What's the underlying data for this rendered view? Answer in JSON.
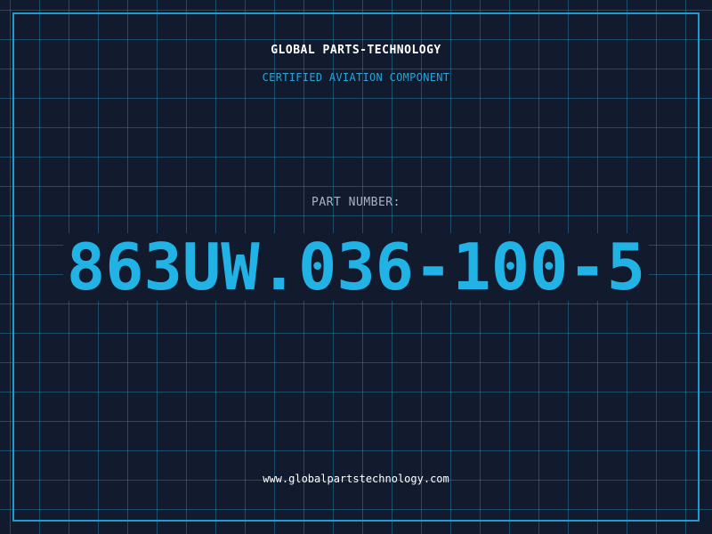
{
  "header": {
    "company_name": "GLOBAL PARTS-TECHNOLOGY",
    "tagline": "CERTIFIED AVIATION COMPONENT"
  },
  "part": {
    "label": "PART NUMBER:",
    "number": "863UW.036-100-5"
  },
  "footer": {
    "website": "www.globalpartstechnology.com"
  },
  "colors": {
    "background": "#121a2e",
    "grid": "#2896be",
    "frame": "#1f9ccc",
    "accent": "#22b3e6",
    "label": "#a9b3c2",
    "text": "#ffffff"
  }
}
